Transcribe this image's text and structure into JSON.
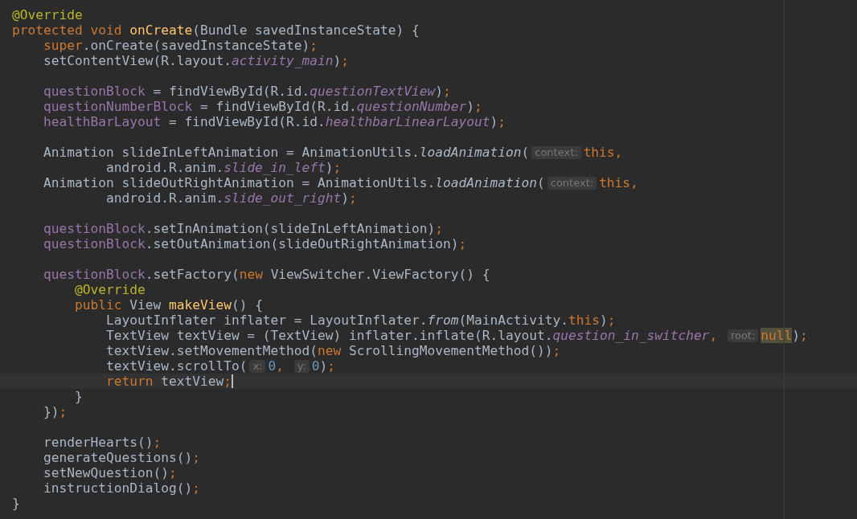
{
  "editor": {
    "lines": [
      {
        "kind": "code",
        "current": false,
        "tokens": [
          {
            "kind": "annotation",
            "text": "@Override"
          }
        ]
      },
      {
        "kind": "code",
        "current": false,
        "tokens": [
          {
            "kind": "keyword",
            "text": "protected void "
          },
          {
            "kind": "declaration",
            "text": "onCreate"
          },
          {
            "kind": "plain",
            "text": "(Bundle savedInstanceState) {"
          }
        ]
      },
      {
        "kind": "code",
        "current": false,
        "tokens": [
          {
            "kind": "keyword",
            "text": "    super"
          },
          {
            "kind": "plain",
            "text": ".onCreate(savedInstanceState)"
          },
          {
            "kind": "keyword",
            "text": ";"
          }
        ]
      },
      {
        "kind": "code",
        "current": false,
        "tokens": [
          {
            "kind": "plain",
            "text": "    setContentView(R.layout."
          },
          {
            "kind": "constant",
            "text": "activity_main"
          },
          {
            "kind": "plain",
            "text": ")"
          },
          {
            "kind": "keyword",
            "text": ";"
          }
        ]
      },
      {
        "kind": "blank",
        "current": false
      },
      {
        "kind": "code",
        "current": false,
        "tokens": [
          {
            "kind": "field",
            "text": "    questionBlock"
          },
          {
            "kind": "plain",
            "text": " = findViewById(R.id."
          },
          {
            "kind": "constant",
            "text": "questionTextView"
          },
          {
            "kind": "plain",
            "text": ")"
          },
          {
            "kind": "keyword",
            "text": ";"
          }
        ]
      },
      {
        "kind": "code",
        "current": false,
        "tokens": [
          {
            "kind": "field",
            "text": "    questionNumberBlock"
          },
          {
            "kind": "plain",
            "text": " = findViewById(R.id."
          },
          {
            "kind": "constant",
            "text": "questionNumber"
          },
          {
            "kind": "plain",
            "text": ")"
          },
          {
            "kind": "keyword",
            "text": ";"
          }
        ]
      },
      {
        "kind": "code",
        "current": false,
        "tokens": [
          {
            "kind": "field",
            "text": "    healthBarLayout"
          },
          {
            "kind": "plain",
            "text": " = findViewById(R.id."
          },
          {
            "kind": "constant",
            "text": "healthbarLinearLayout"
          },
          {
            "kind": "plain",
            "text": ")"
          },
          {
            "kind": "keyword",
            "text": ";"
          }
        ]
      },
      {
        "kind": "blank",
        "current": false
      },
      {
        "kind": "code",
        "current": false,
        "tokens": [
          {
            "kind": "plain",
            "text": "    Animation slideInLeftAnimation = AnimationUtils."
          },
          {
            "kind": "static",
            "text": "loadAnimation"
          },
          {
            "kind": "plain",
            "text": "("
          },
          {
            "kind": "hint",
            "text": "context:"
          },
          {
            "kind": "keyword",
            "text": "this,"
          }
        ]
      },
      {
        "kind": "code",
        "current": false,
        "tokens": [
          {
            "kind": "plain",
            "text": "            android.R.anim."
          },
          {
            "kind": "constant",
            "text": "slide_in_left"
          },
          {
            "kind": "plain",
            "text": ")"
          },
          {
            "kind": "keyword",
            "text": ";"
          }
        ]
      },
      {
        "kind": "code",
        "current": false,
        "tokens": [
          {
            "kind": "plain",
            "text": "    Animation slideOutRightAnimation = AnimationUtils."
          },
          {
            "kind": "static",
            "text": "loadAnimation"
          },
          {
            "kind": "plain",
            "text": "("
          },
          {
            "kind": "hint",
            "text": "context:"
          },
          {
            "kind": "keyword",
            "text": "this,"
          }
        ]
      },
      {
        "kind": "code",
        "current": false,
        "tokens": [
          {
            "kind": "plain",
            "text": "            android.R.anim."
          },
          {
            "kind": "constant",
            "text": "slide_out_right"
          },
          {
            "kind": "plain",
            "text": ")"
          },
          {
            "kind": "keyword",
            "text": ";"
          }
        ]
      },
      {
        "kind": "blank",
        "current": false
      },
      {
        "kind": "code",
        "current": false,
        "tokens": [
          {
            "kind": "field",
            "text": "    questionBlock"
          },
          {
            "kind": "plain",
            "text": ".setInAnimation(slideInLeftAnimation)"
          },
          {
            "kind": "keyword",
            "text": ";"
          }
        ]
      },
      {
        "kind": "code",
        "current": false,
        "tokens": [
          {
            "kind": "field",
            "text": "    questionBlock"
          },
          {
            "kind": "plain",
            "text": ".setOutAnimation(slideOutRightAnimation)"
          },
          {
            "kind": "keyword",
            "text": ";"
          }
        ]
      },
      {
        "kind": "blank",
        "current": false
      },
      {
        "kind": "code",
        "current": false,
        "tokens": [
          {
            "kind": "field",
            "text": "    questionBlock"
          },
          {
            "kind": "plain",
            "text": ".setFactory("
          },
          {
            "kind": "keyword",
            "text": "new "
          },
          {
            "kind": "plain",
            "text": "ViewSwitcher.ViewFactory() {"
          }
        ]
      },
      {
        "kind": "code",
        "current": false,
        "tokens": [
          {
            "kind": "annotation",
            "text": "        @Override"
          }
        ]
      },
      {
        "kind": "code",
        "current": false,
        "tokens": [
          {
            "kind": "keyword",
            "text": "        public "
          },
          {
            "kind": "plain",
            "text": "View "
          },
          {
            "kind": "declaration",
            "text": "makeView"
          },
          {
            "kind": "plain",
            "text": "() {"
          }
        ]
      },
      {
        "kind": "code",
        "current": false,
        "tokens": [
          {
            "kind": "plain",
            "text": "            LayoutInflater inflater = LayoutInflater."
          },
          {
            "kind": "static",
            "text": "from"
          },
          {
            "kind": "plain",
            "text": "(MainActivity."
          },
          {
            "kind": "keyword",
            "text": "this"
          },
          {
            "kind": "plain",
            "text": ")"
          },
          {
            "kind": "keyword",
            "text": ";"
          }
        ]
      },
      {
        "kind": "code",
        "current": false,
        "tokens": [
          {
            "kind": "plain",
            "text": "            TextView textView = (TextView) inflater.inflate(R.layout."
          },
          {
            "kind": "constant",
            "text": "question_in_switcher"
          },
          {
            "kind": "keyword",
            "text": ", "
          },
          {
            "kind": "hint",
            "text": "root:"
          },
          {
            "kind": "match",
            "text": "null"
          },
          {
            "kind": "plain",
            "text": ")"
          },
          {
            "kind": "keyword",
            "text": ";"
          }
        ]
      },
      {
        "kind": "code",
        "current": false,
        "tokens": [
          {
            "kind": "plain",
            "text": "            textView.setMovementMethod("
          },
          {
            "kind": "keyword",
            "text": "new "
          },
          {
            "kind": "plain",
            "text": "ScrollingMovementMethod())"
          },
          {
            "kind": "keyword",
            "text": ";"
          }
        ]
      },
      {
        "kind": "code",
        "current": false,
        "tokens": [
          {
            "kind": "plain",
            "text": "            textView.scrollTo("
          },
          {
            "kind": "hint",
            "text": "x:"
          },
          {
            "kind": "number",
            "text": "0"
          },
          {
            "kind": "keyword",
            "text": ", "
          },
          {
            "kind": "hint",
            "text": "y:"
          },
          {
            "kind": "number",
            "text": "0"
          },
          {
            "kind": "plain",
            "text": ")"
          },
          {
            "kind": "keyword",
            "text": ";"
          }
        ]
      },
      {
        "kind": "code",
        "current": true,
        "tokens": [
          {
            "kind": "keyword",
            "text": "            return "
          },
          {
            "kind": "plain",
            "text": "textView"
          },
          {
            "kind": "keyword",
            "text": ";"
          }
        ]
      },
      {
        "kind": "code",
        "current": false,
        "tokens": [
          {
            "kind": "plain",
            "text": "        }"
          }
        ]
      },
      {
        "kind": "code",
        "current": false,
        "tokens": [
          {
            "kind": "plain",
            "text": "    })"
          },
          {
            "kind": "keyword",
            "text": ";"
          }
        ]
      },
      {
        "kind": "blank",
        "current": false
      },
      {
        "kind": "code",
        "current": false,
        "tokens": [
          {
            "kind": "plain",
            "text": "    renderHearts()"
          },
          {
            "kind": "keyword",
            "text": ";"
          }
        ]
      },
      {
        "kind": "code",
        "current": false,
        "tokens": [
          {
            "kind": "plain",
            "text": "    generateQuestions()"
          },
          {
            "kind": "keyword",
            "text": ";"
          }
        ]
      },
      {
        "kind": "code",
        "current": false,
        "tokens": [
          {
            "kind": "plain",
            "text": "    setNewQuestion()"
          },
          {
            "kind": "keyword",
            "text": ";"
          }
        ]
      },
      {
        "kind": "code",
        "current": false,
        "tokens": [
          {
            "kind": "plain",
            "text": "    instructionDialog()"
          },
          {
            "kind": "keyword",
            "text": ";"
          }
        ]
      },
      {
        "kind": "code",
        "current": false,
        "tokens": [
          {
            "kind": "plain",
            "text": "}"
          }
        ]
      }
    ]
  }
}
